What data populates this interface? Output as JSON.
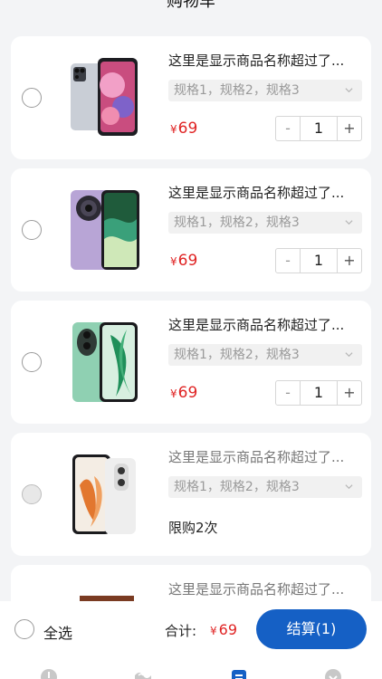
{
  "header": {
    "title": "购物车"
  },
  "items": [
    {
      "name": "这里是显示商品名称超过了...",
      "spec": "规格1，规格2，规格3",
      "currency": "¥",
      "price": "69",
      "qty": "1",
      "minus": "-",
      "plus": "+",
      "limit": "",
      "disabled": false
    },
    {
      "name": "这里是显示商品名称超过了...",
      "spec": "规格1，规格2，规格3",
      "currency": "¥",
      "price": "69",
      "qty": "1",
      "minus": "-",
      "plus": "+",
      "limit": "",
      "disabled": false
    },
    {
      "name": "这里是显示商品名称超过了...",
      "spec": "规格1，规格2，规格3",
      "currency": "¥",
      "price": "69",
      "qty": "1",
      "minus": "-",
      "plus": "+",
      "limit": "",
      "disabled": false
    },
    {
      "name": "这里是显示商品名称超过了...",
      "spec": "规格1，规格2，规格3",
      "currency": "",
      "price": "",
      "qty": "",
      "minus": "",
      "plus": "",
      "limit": "限购2次",
      "disabled": true
    },
    {
      "name": "这里是显示商品名称超过了...",
      "spec": "",
      "currency": "",
      "price": "",
      "qty": "",
      "minus": "",
      "plus": "",
      "limit": "",
      "disabled": true
    }
  ],
  "footer": {
    "select_all": "全选",
    "total_label": "合计:",
    "total_currency": "¥",
    "total_value": "69",
    "checkout": "结算(1)"
  },
  "colors": {
    "accent": "#1560c5",
    "price": "#e02424"
  },
  "tabbar": {
    "icons": [
      "home-icon",
      "category-icon",
      "cart-icon",
      "profile-icon"
    ],
    "active_index": 2
  }
}
